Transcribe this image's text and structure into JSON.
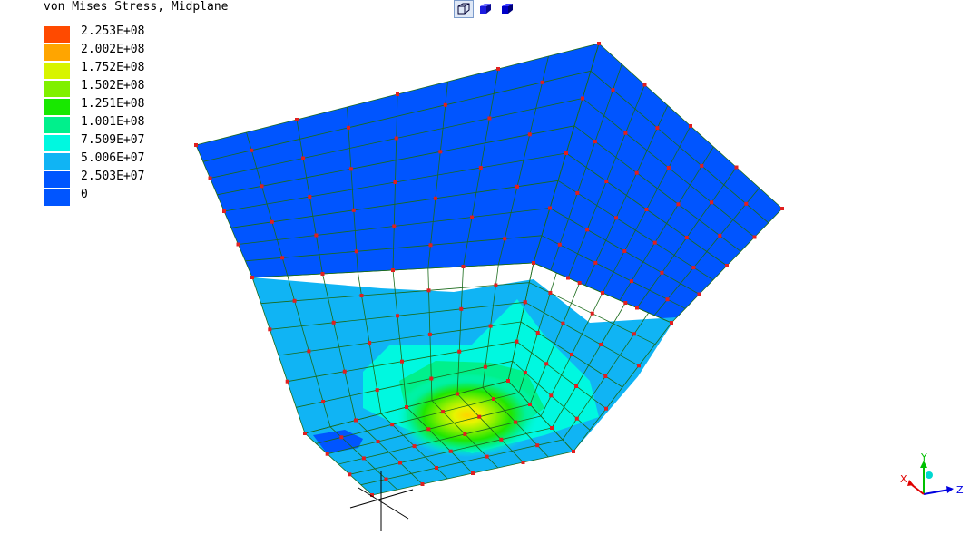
{
  "plot_title": "von Mises Stress, Midplane",
  "legend": [
    {
      "label": "2.253E+08",
      "color": "#ff4a00"
    },
    {
      "label": "2.002E+08",
      "color": "#ffa500"
    },
    {
      "label": "1.752E+08",
      "color": "#d8f400"
    },
    {
      "label": "1.502E+08",
      "color": "#80f000"
    },
    {
      "label": "1.251E+08",
      "color": "#18e800"
    },
    {
      "label": "1.001E+08",
      "color": "#00f08c"
    },
    {
      "label": "7.509E+07",
      "color": "#00f8e0"
    },
    {
      "label": "5.006E+07",
      "color": "#10b4f4"
    },
    {
      "label": "2.503E+07",
      "color": "#0055ff"
    },
    {
      "label": "0",
      "color": ""
    }
  ],
  "toolbar": [
    {
      "icon": "wireframe-cube-icon",
      "active": true
    },
    {
      "icon": "shaded-cube-icon",
      "active": false
    },
    {
      "icon": "solid-cube-icon",
      "active": false
    }
  ],
  "axis_triad": {
    "x": "X",
    "y": "Y",
    "z": "Z",
    "x_color": "#e00000",
    "y_color": "#00c000",
    "z_color": "#0000e0"
  },
  "colors": {
    "mesh_line": "#1a6a1a",
    "node": "#e02020",
    "base_blue": "#0055ff"
  }
}
